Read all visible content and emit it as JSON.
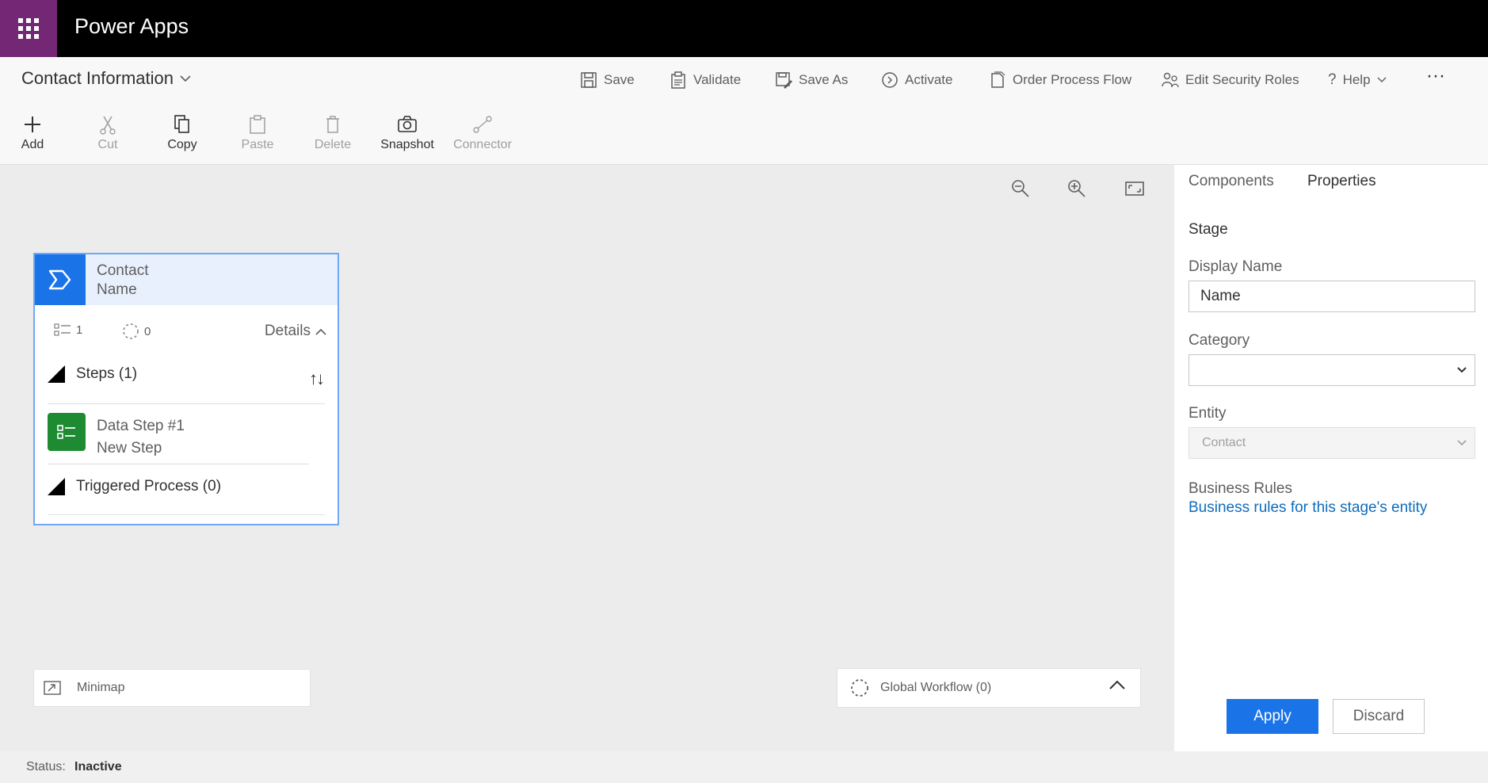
{
  "app": {
    "name": "Power Apps"
  },
  "commandbar": {
    "process_title": "Contact Information",
    "commands": {
      "save": "Save",
      "validate": "Validate",
      "save_as": "Save As",
      "activate": "Activate",
      "order_process_flow": "Order Process Flow",
      "edit_security_roles": "Edit Security Roles",
      "help": "Help",
      "more": "···"
    },
    "ribbon": {
      "add": "Add",
      "cut": "Cut",
      "copy": "Copy",
      "paste": "Paste",
      "delete": "Delete",
      "snapshot": "Snapshot",
      "connector": "Connector"
    }
  },
  "stage_card": {
    "category": "Contact",
    "name": "Name",
    "steps_count": "1",
    "workflows_count": "0",
    "details_label": "Details",
    "steps_label": "Steps (1)",
    "data_step_title": "Data Step #1",
    "data_step_subtitle": "New Step",
    "triggered_label": "Triggered Process (0)"
  },
  "canvas": {
    "minimap_label": "Minimap",
    "global_workflow_label": "Global Workflow (0)"
  },
  "status": {
    "label": "Status:",
    "value": "Inactive"
  },
  "panel": {
    "tabs": {
      "components": "Components",
      "properties": "Properties"
    },
    "heading": "Stage",
    "display_name_label": "Display Name",
    "display_name_value": "Name",
    "category_label": "Category",
    "category_value": "",
    "entity_label": "Entity",
    "entity_value": "Contact",
    "business_rules_label": "Business Rules",
    "business_rules_link": "Business rules for this stage's entity",
    "apply_label": "Apply",
    "discard_label": "Discard"
  },
  "colors": {
    "accent": "#1b73e8",
    "waffle": "#742774",
    "step_icon": "#1e8b32"
  }
}
